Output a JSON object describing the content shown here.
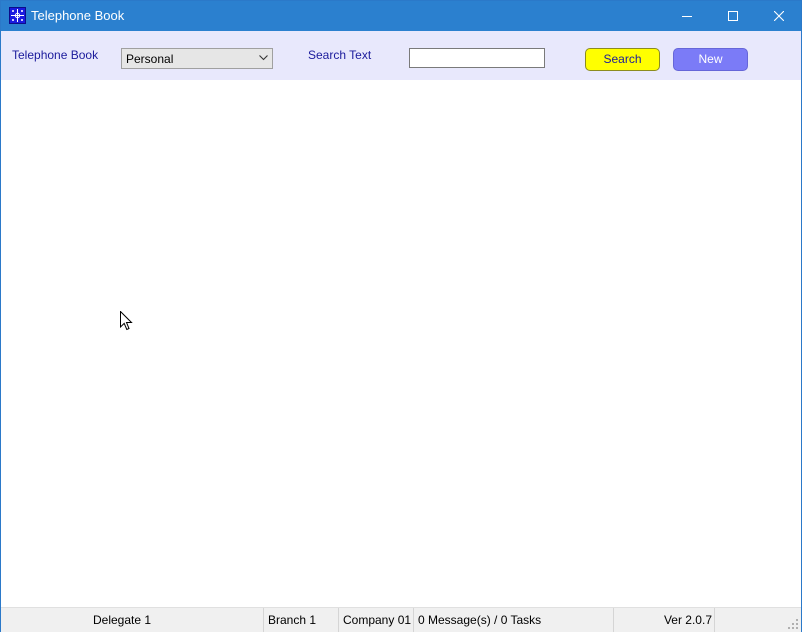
{
  "window": {
    "title": "Telephone Book",
    "icons": {
      "app": "telephone-book-app-icon",
      "minimize": "minimize-icon",
      "maximize": "maximize-icon",
      "close": "close-icon"
    }
  },
  "toolbar": {
    "book_label": "Telephone Book",
    "book_selected": "Personal",
    "search_label": "Search Text",
    "search_value": "",
    "search_button": "Search",
    "new_button": "New",
    "colors": {
      "search_button_bg": "#ffff00",
      "new_button_bg": "#7b7bf7",
      "toolbar_bg": "#e8e8fc",
      "label_text": "#1b1b9c"
    }
  },
  "statusbar": {
    "delegate": "Delegate 1",
    "branch": "Branch 1",
    "company": "Company 01",
    "messages": "0 Message(s) / 0 Tasks",
    "version": "Ver 2.0.7"
  }
}
